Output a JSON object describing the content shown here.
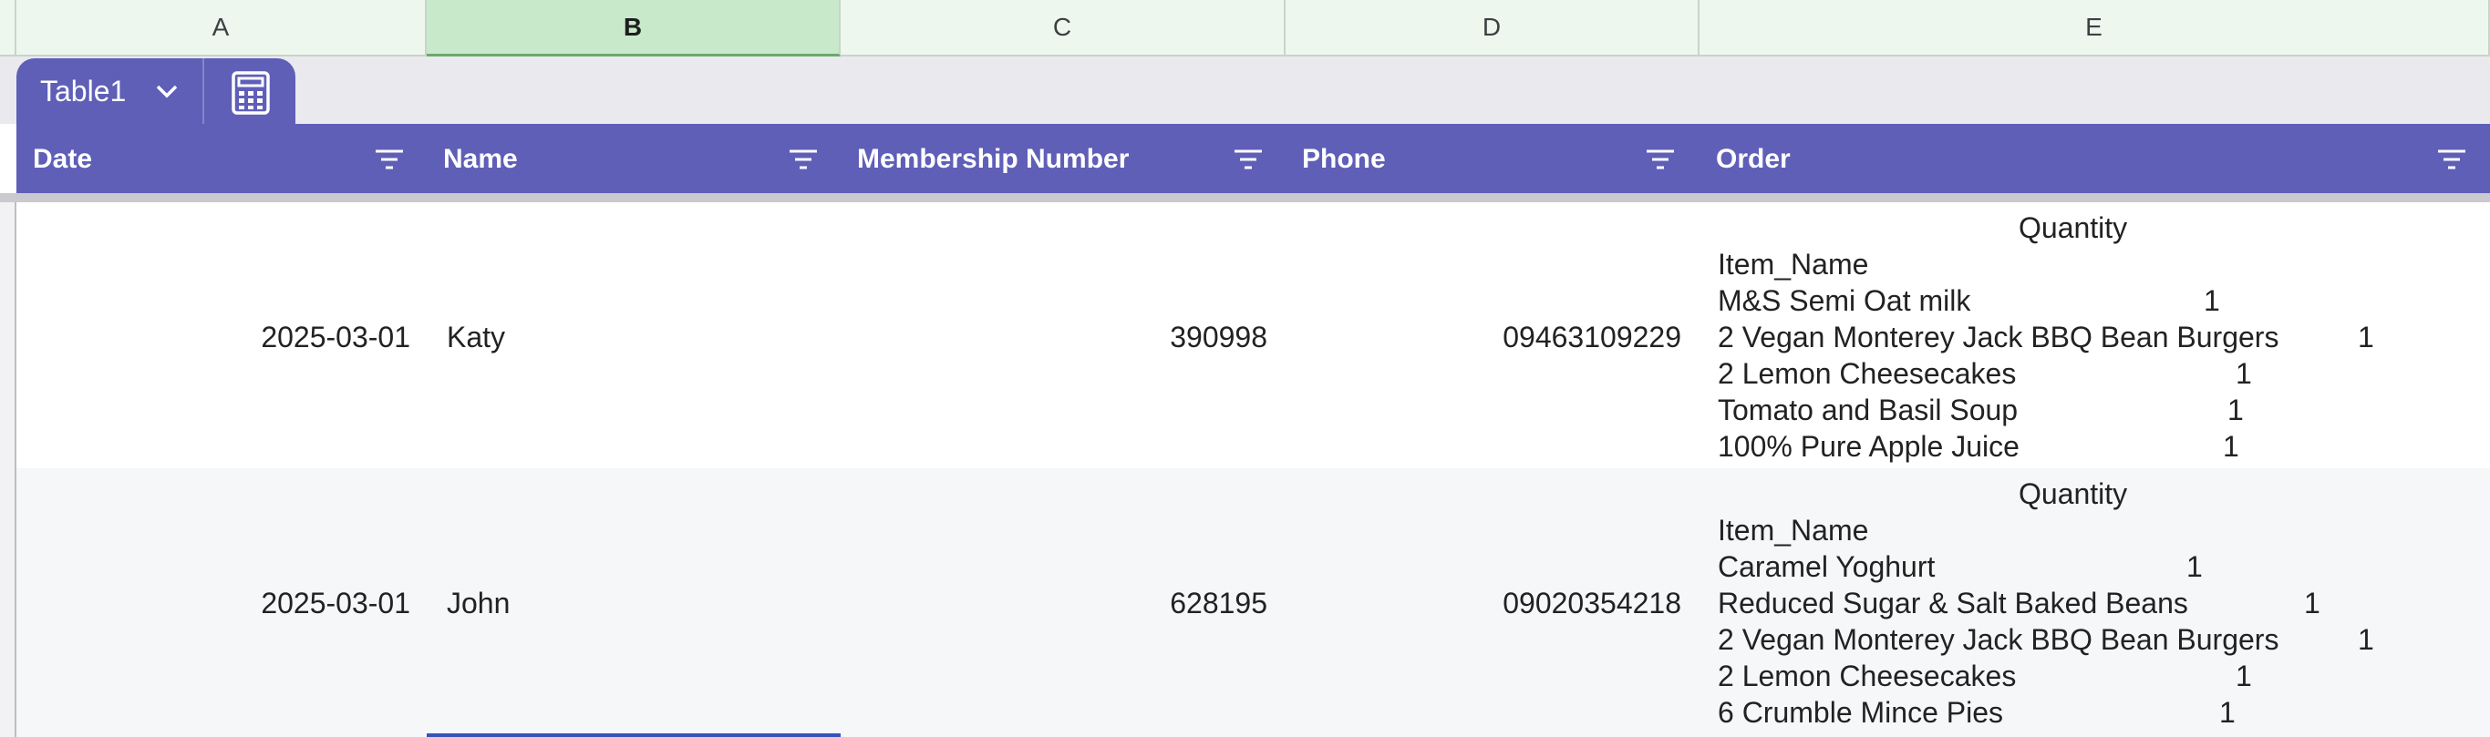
{
  "columns": [
    "A",
    "B",
    "C",
    "D",
    "E"
  ],
  "selected_column": "B",
  "table_tab": {
    "name": "Table1",
    "dropdown_icon": "chevron-down-icon",
    "calc_icon": "calculator-icon"
  },
  "headers": [
    "Date",
    "Name",
    "Membership Number",
    "Phone",
    "Order"
  ],
  "filter_icon": "filter-icon",
  "rows": [
    {
      "date": "2025-03-01",
      "name": "Katy",
      "membership": "390998",
      "phone": "09463109229",
      "order": {
        "quantity_header": "Quantity",
        "item_header": "Item_Name",
        "items": [
          {
            "name": "M&S Semi Oat milk",
            "qty": "1"
          },
          {
            "name": "2 Vegan Monterey Jack BBQ Bean Burgers",
            "qty": "1"
          },
          {
            "name": "2 Lemon Cheesecakes",
            "qty": "1"
          },
          {
            "name": "Tomato and Basil Soup",
            "qty": "1"
          },
          {
            "name": "100% Pure Apple Juice",
            "qty": "1"
          }
        ]
      }
    },
    {
      "date": "2025-03-01",
      "name": "John",
      "membership": "628195",
      "phone": "09020354218",
      "order": {
        "quantity_header": "Quantity",
        "item_header": "Item_Name",
        "items": [
          {
            "name": "Caramel Yoghurt",
            "qty": "1"
          },
          {
            "name": "Reduced Sugar & Salt Baked Beans",
            "qty": "1"
          },
          {
            "name": "2 Vegan Monterey Jack BBQ Bean Burgers",
            "qty": "1"
          },
          {
            "name": "2 Lemon Cheesecakes",
            "qty": "1"
          },
          {
            "name": "6 Crumble Mince Pies",
            "qty": "1"
          }
        ]
      }
    }
  ],
  "colors": {
    "accent": "#5f5fb8",
    "row_alt": "#f6f7f9",
    "col_header_bg": "#eef7ee",
    "col_header_selected": "#c9e9cb"
  }
}
